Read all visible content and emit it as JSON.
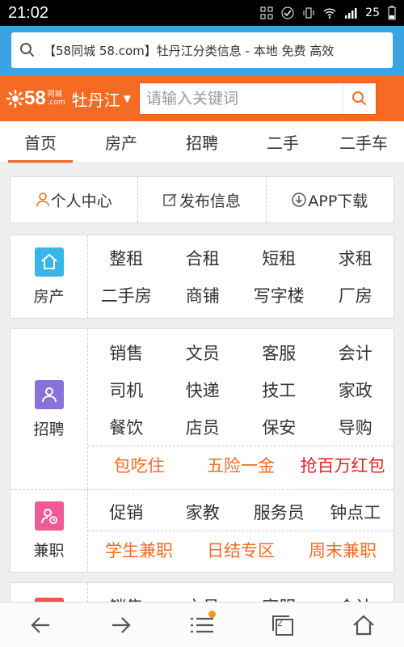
{
  "status": {
    "time": "21:02",
    "battery": "25"
  },
  "browser": {
    "url_text": "【58同城 58.com】牡丹江分类信息 - 本地 免费 高效"
  },
  "header": {
    "logo_num": "58",
    "logo_sub_top": "同城",
    "logo_sub_bottom": ".com",
    "city": "牡丹江",
    "search_placeholder": "请输入关键词"
  },
  "nav": {
    "tabs": [
      {
        "label": "首页"
      },
      {
        "label": "房产"
      },
      {
        "label": "招聘"
      },
      {
        "label": "二手"
      },
      {
        "label": "二手车"
      }
    ]
  },
  "quick": [
    {
      "label": "个人中心"
    },
    {
      "label": "发布信息"
    },
    {
      "label": "APP下载"
    }
  ],
  "house": {
    "label": "房产",
    "rows": [
      [
        "整租",
        "合租",
        "短租",
        "求租"
      ],
      [
        "二手房",
        "商铺",
        "写字楼",
        "厂房"
      ]
    ]
  },
  "jobs": {
    "label": "招聘",
    "rows": [
      [
        "销售",
        "文员",
        "客服",
        "会计"
      ],
      [
        "司机",
        "快递",
        "技工",
        "家政"
      ],
      [
        "餐饮",
        "店员",
        "保安",
        "导购"
      ]
    ],
    "hot": [
      "包吃住",
      "五险一金",
      "抢百万红包"
    ]
  },
  "parttime": {
    "label": "兼职",
    "row": [
      "促销",
      "家教",
      "服务员",
      "钟点工"
    ],
    "hot": [
      "学生兼职",
      "日结专区",
      "周末兼职"
    ]
  },
  "partial": {
    "row": [
      "销售",
      "文员",
      "客服",
      "会计"
    ]
  },
  "bottom": {
    "tabs_count": "2"
  },
  "colors": {
    "brand_orange": "#f66b24",
    "browser_blue": "#3aa4e3",
    "house_icon": "#35b8e8",
    "jobs_icon": "#8a72d8",
    "parttime_icon": "#ef5a97",
    "hot_red": "#e02020"
  }
}
